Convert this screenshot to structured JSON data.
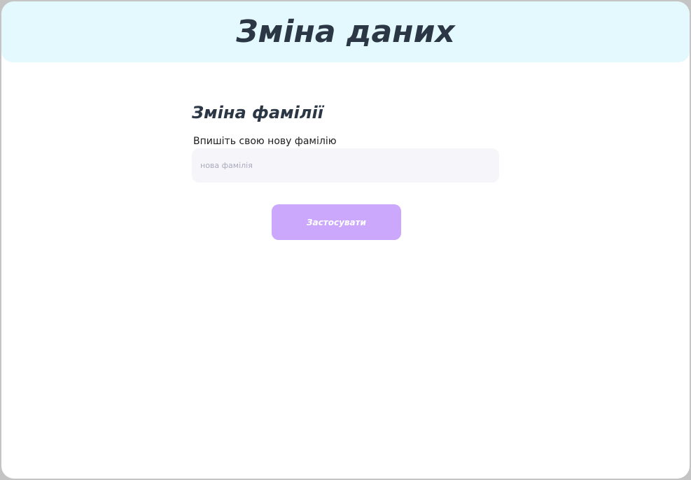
{
  "header": {
    "title": "Зміна даних"
  },
  "form": {
    "section_title": "Зміна фамілії",
    "label": "Впишіть свою нову фамілію",
    "input": {
      "placeholder": "нова фамілія",
      "value": ""
    },
    "apply_label": "Застосувати"
  },
  "colors": {
    "header_bg": "#e4f9fe",
    "title_text": "#2c3746",
    "input_bg": "#f6f6fa",
    "button_bg": "#cba8fc",
    "button_text": "#ffffff",
    "outer_border": "#c4c4c4"
  }
}
